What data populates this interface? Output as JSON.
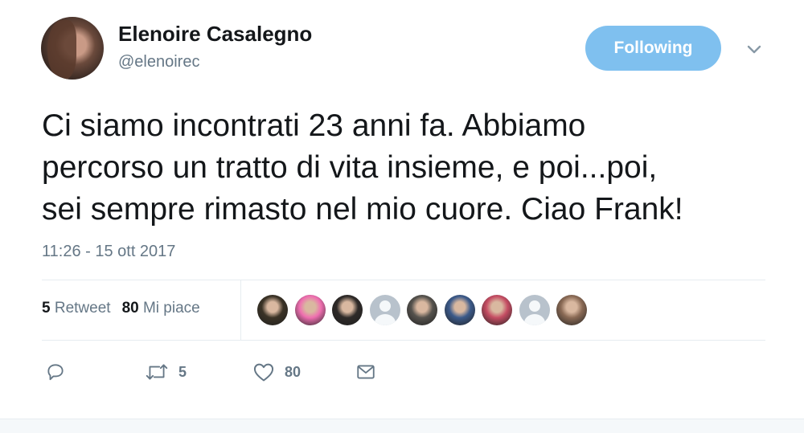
{
  "author": {
    "display_name": "Elenoire Casalegno",
    "handle": "@elenoirec"
  },
  "follow_button": {
    "label": "Following"
  },
  "tweet": {
    "lines": [
      "Ci siamo incontrati 23 anni fa. Abbiamo",
      "percorso un tratto di vita insieme, e poi...poi,",
      "sei sempre rimasto nel mio cuore. Ciao Frank!"
    ],
    "timestamp": "11:26 - 15 ott 2017"
  },
  "stats": {
    "retweet_count": "5",
    "retweet_label": "Retweet",
    "like_count": "80",
    "like_label": "Mi piace"
  },
  "likers": [
    {
      "icon": "liker-avatar-1",
      "bg": "#3b3326"
    },
    {
      "icon": "liker-avatar-2",
      "bg": "#ef6fb0"
    },
    {
      "icon": "liker-avatar-3",
      "bg": "#2e2a28"
    },
    {
      "icon": "default-avatar-icon",
      "bg": "#b8c2cc"
    },
    {
      "icon": "liker-avatar-5",
      "bg": "#55524d"
    },
    {
      "icon": "liker-avatar-6",
      "bg": "#3c5a8a"
    },
    {
      "icon": "liker-avatar-7",
      "bg": "#c54d63"
    },
    {
      "icon": "default-avatar-icon",
      "bg": "#b8c2cc"
    },
    {
      "icon": "liker-avatar-9",
      "bg": "#8a6a55"
    }
  ],
  "actions": {
    "reply_icon": "reply-icon",
    "retweet_icon": "retweet-icon",
    "retweet_count": "5",
    "like_icon": "heart-icon",
    "like_count": "80",
    "dm_icon": "envelope-icon"
  },
  "colors": {
    "accent": "#1da1f2",
    "following_button": "#7fc0ef",
    "secondary_text": "#657786"
  }
}
